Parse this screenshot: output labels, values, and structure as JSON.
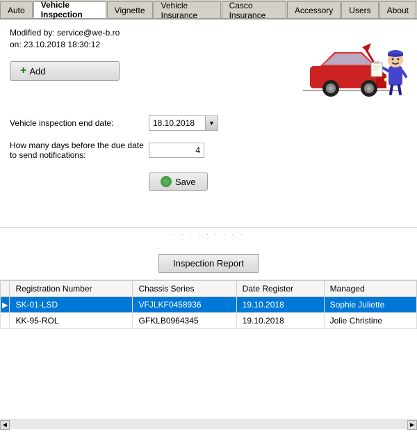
{
  "tabs": [
    {
      "id": "auto",
      "label": "Auto",
      "active": false
    },
    {
      "id": "vehicle-inspection",
      "label": "Vehicle Inspection",
      "active": true
    },
    {
      "id": "vignette",
      "label": "Vignette",
      "active": false
    },
    {
      "id": "vehicle-insurance",
      "label": "Vehicle Insurance",
      "active": false
    },
    {
      "id": "casco-insurance",
      "label": "Casco Insurance",
      "active": false
    },
    {
      "id": "accessory",
      "label": "Accessory",
      "active": false
    },
    {
      "id": "users",
      "label": "Users",
      "active": false
    },
    {
      "id": "about",
      "label": "About",
      "active": false
    }
  ],
  "form": {
    "modified_by_label": "Modified by:",
    "modified_by_value": "service@we-b.ro",
    "on_label": "on:",
    "on_value": "23.10.2018 18:30:12",
    "add_button": "Add",
    "end_date_label": "Vehicle inspection end date:",
    "end_date_value": "18.10.2018",
    "days_label": "How many days before the due date to send notifications:",
    "days_value": "4",
    "save_button": "Save"
  },
  "report": {
    "button_label": "Inspection Report"
  },
  "table": {
    "columns": [
      {
        "id": "indicator",
        "label": ""
      },
      {
        "id": "reg_number",
        "label": "Registration Number"
      },
      {
        "id": "chassis",
        "label": "Chassis Series"
      },
      {
        "id": "date_register",
        "label": "Date Register"
      },
      {
        "id": "managed",
        "label": "Managed"
      }
    ],
    "rows": [
      {
        "indicator": "▶",
        "reg_number": "SK-01-LSD",
        "chassis": "VFJLKF0458936",
        "date_register": "19.10.2018",
        "managed": "Sophie Juliette",
        "selected": true
      },
      {
        "indicator": "",
        "reg_number": "KK-95-ROL",
        "chassis": "GFKLB0964345",
        "date_register": "19.10.2018",
        "managed": "Jolie Christine",
        "selected": false
      }
    ]
  }
}
